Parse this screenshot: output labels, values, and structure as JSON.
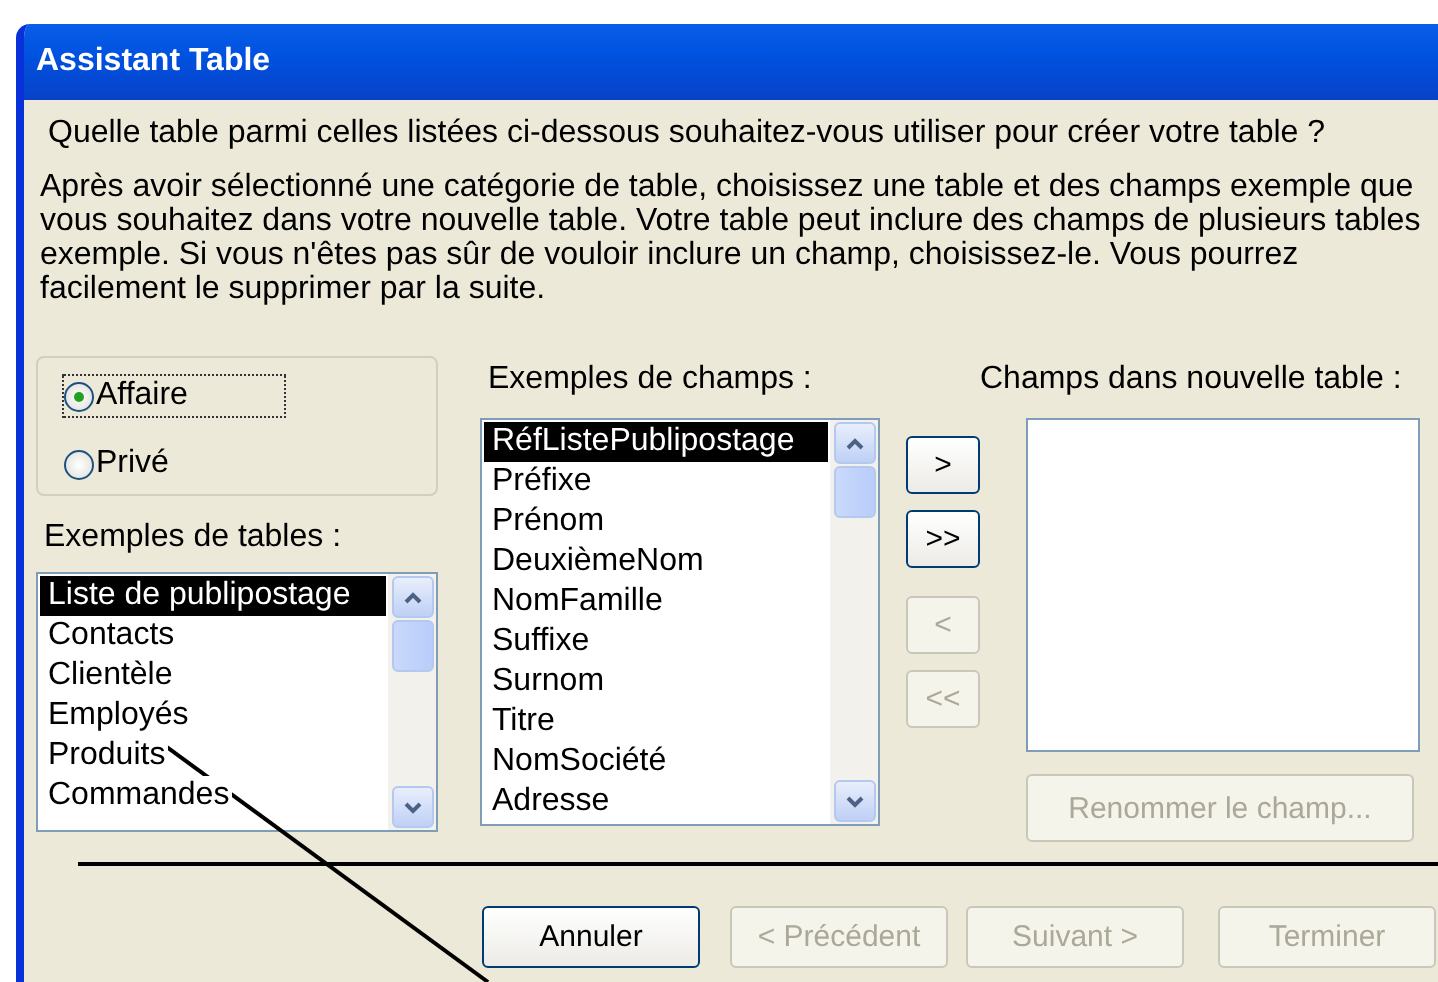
{
  "window": {
    "title": "Assistant Table"
  },
  "question": "Quelle table parmi celles listées ci-dessous souhaitez-vous utiliser pour créer votre table ?",
  "instructions": "Après avoir sélectionné une catégorie de table, choisissez une table et des champs exemple que vous souhaitez dans votre nouvelle table. Votre table peut inclure des champs de plusieurs tables exemple. Si vous n'êtes pas sûr de vouloir inclure un champ, choisissez-le. Vous pourrez facilement le supprimer par la suite.",
  "category_options": [
    {
      "label": "Affaire",
      "selected": true,
      "focused": true
    },
    {
      "label": "Privé",
      "selected": false,
      "focused": false
    }
  ],
  "sample_tables": {
    "label": "Exemples de tables :",
    "items": [
      {
        "label": "Liste de publipostage",
        "selected": true
      },
      {
        "label": "Contacts",
        "selected": false
      },
      {
        "label": "Clientèle",
        "selected": false
      },
      {
        "label": "Employés",
        "selected": false
      },
      {
        "label": "Produits",
        "selected": false
      },
      {
        "label": "Commandes",
        "selected": false
      }
    ]
  },
  "sample_fields": {
    "label": "Exemples de champs :",
    "items": [
      {
        "label": "RéfListePublipostage",
        "selected": true
      },
      {
        "label": "Préfixe",
        "selected": false
      },
      {
        "label": "Prénom",
        "selected": false
      },
      {
        "label": "DeuxièmeNom",
        "selected": false
      },
      {
        "label": "NomFamille",
        "selected": false
      },
      {
        "label": "Suffixe",
        "selected": false
      },
      {
        "label": "Surnom",
        "selected": false
      },
      {
        "label": "Titre",
        "selected": false
      },
      {
        "label": "NomSociété",
        "selected": false
      },
      {
        "label": "Adresse",
        "selected": false
      }
    ]
  },
  "move_buttons": [
    {
      "label": ">",
      "disabled": false
    },
    {
      "label": ">>",
      "disabled": false
    },
    {
      "label": "<",
      "disabled": true
    },
    {
      "label": "<<",
      "disabled": true
    }
  ],
  "new_table_fields": {
    "label": "Champs dans nouvelle table :"
  },
  "rename_button": {
    "label": "Renommer le champ...",
    "disabled": true
  },
  "footer_buttons": [
    {
      "label": "Annuler",
      "disabled": false
    },
    {
      "label": "< Précédent",
      "disabled": true
    },
    {
      "label": "Suivant >",
      "disabled": true
    },
    {
      "label": "Terminer",
      "disabled": true
    }
  ]
}
